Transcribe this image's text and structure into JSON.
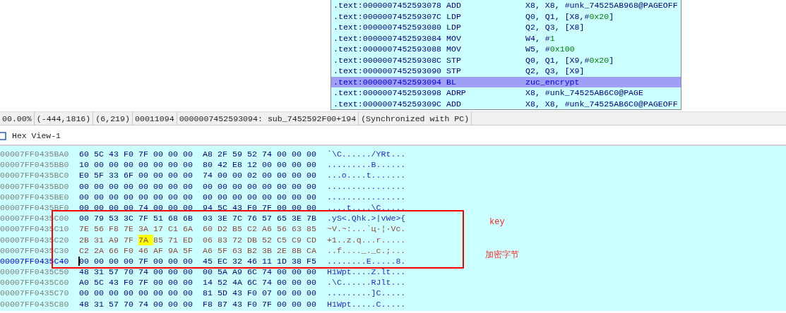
{
  "disassembly": {
    "lines": [
      {
        "address": ".text:0000007452593078",
        "mnemonic": "ADD",
        "operands": [
          {
            "kind": "plain",
            "text": "X8, X8, #unk_74525AB968@PAGEOFF"
          }
        ],
        "selected": false
      },
      {
        "address": ".text:000000745259307C",
        "mnemonic": "LDP",
        "operands": [
          {
            "kind": "plain",
            "text": "Q0, Q1, [X8,#"
          },
          {
            "kind": "number",
            "text": "0x20"
          },
          {
            "kind": "plain",
            "text": "]"
          }
        ],
        "selected": false
      },
      {
        "address": ".text:0000007452593080",
        "mnemonic": "LDP",
        "operands": [
          {
            "kind": "plain",
            "text": "Q2, Q3, [X8]"
          }
        ],
        "selected": false
      },
      {
        "address": ".text:0000007452593084",
        "mnemonic": "MOV",
        "operands": [
          {
            "kind": "plain",
            "text": "W4, #"
          },
          {
            "kind": "number",
            "text": "1"
          }
        ],
        "selected": false
      },
      {
        "address": ".text:0000007452593088",
        "mnemonic": "MOV",
        "operands": [
          {
            "kind": "plain",
            "text": "W5, #"
          },
          {
            "kind": "number",
            "text": "0x100"
          }
        ],
        "selected": false
      },
      {
        "address": ".text:000000745259308C",
        "mnemonic": "STP",
        "operands": [
          {
            "kind": "plain",
            "text": "Q0, Q1, [X9,#"
          },
          {
            "kind": "number",
            "text": "0x20"
          },
          {
            "kind": "plain",
            "text": "]"
          }
        ],
        "selected": false
      },
      {
        "address": ".text:0000007452593090",
        "mnemonic": "STP",
        "operands": [
          {
            "kind": "plain",
            "text": "Q2, Q3, [X9]"
          }
        ],
        "selected": false
      },
      {
        "address": ".text:0000007452593094",
        "mnemonic": "BL",
        "operands": [
          {
            "kind": "plain",
            "text": "zuc_encrypt"
          }
        ],
        "selected": true
      },
      {
        "address": ".text:0000007452593098",
        "mnemonic": "ADRP",
        "operands": [
          {
            "kind": "plain",
            "text": "X8, #unk_74525AB6C0@PAGE"
          }
        ],
        "selected": false
      },
      {
        "address": ".text:000000745259309C",
        "mnemonic": "ADD",
        "operands": [
          {
            "kind": "plain",
            "text": "X8, X8, #unk_74525AB6C0@PAGEOFF"
          }
        ],
        "selected": false
      }
    ]
  },
  "status_bar": {
    "segments": [
      "00.00%",
      "(-444,1816)",
      "(6,219)",
      "00011094",
      "0000007452593094: sub_7452592F00+194",
      "(Synchronized with PC)"
    ]
  },
  "hex_view": {
    "tab": {
      "title": "Hex View-1"
    },
    "rows": [
      {
        "address": "00007FF0435BA0",
        "bytes": [
          {
            "text": "60",
            "selected": false
          },
          {
            "text": "5C",
            "selected": false
          },
          {
            "text": "43",
            "selected": false
          },
          {
            "text": "F0",
            "selected": false
          },
          {
            "text": "7F",
            "selected": false
          },
          {
            "text": "00",
            "selected": false
          },
          {
            "text": "00",
            "selected": false
          },
          {
            "text": "00",
            "selected": false
          },
          {
            "text": "A8",
            "selected": false
          },
          {
            "text": "2F",
            "selected": false
          },
          {
            "text": "59",
            "selected": false
          },
          {
            "text": "52",
            "selected": false
          },
          {
            "text": "74",
            "selected": false
          },
          {
            "text": "00",
            "selected": false
          },
          {
            "text": "00",
            "selected": false
          },
          {
            "text": "00",
            "selected": false
          }
        ],
        "ascii": "`\\C....../YRt...",
        "current": false,
        "changed": false,
        "boxed": false
      },
      {
        "address": "00007FF0435BB0",
        "bytes": [
          {
            "text": "10",
            "selected": false
          },
          {
            "text": "00",
            "selected": false
          },
          {
            "text": "00",
            "selected": false
          },
          {
            "text": "00",
            "selected": false
          },
          {
            "text": "00",
            "selected": false
          },
          {
            "text": "00",
            "selected": false
          },
          {
            "text": "00",
            "selected": false
          },
          {
            "text": "00",
            "selected": false
          },
          {
            "text": "80",
            "selected": false
          },
          {
            "text": "42",
            "selected": false
          },
          {
            "text": "E8",
            "selected": false
          },
          {
            "text": "12",
            "selected": false
          },
          {
            "text": "00",
            "selected": false
          },
          {
            "text": "00",
            "selected": false
          },
          {
            "text": "00",
            "selected": false
          },
          {
            "text": "00",
            "selected": false
          }
        ],
        "ascii": ".........B......",
        "current": false,
        "changed": false,
        "boxed": false
      },
      {
        "address": "00007FF0435BC0",
        "bytes": [
          {
            "text": "E0",
            "selected": false
          },
          {
            "text": "5F",
            "selected": false
          },
          {
            "text": "33",
            "selected": false
          },
          {
            "text": "6F",
            "selected": false
          },
          {
            "text": "00",
            "selected": false
          },
          {
            "text": "00",
            "selected": false
          },
          {
            "text": "00",
            "selected": false
          },
          {
            "text": "00",
            "selected": false
          },
          {
            "text": "74",
            "selected": false
          },
          {
            "text": "00",
            "selected": false
          },
          {
            "text": "00",
            "selected": false
          },
          {
            "text": "02",
            "selected": false
          },
          {
            "text": "00",
            "selected": false
          },
          {
            "text": "00",
            "selected": false
          },
          {
            "text": "00",
            "selected": false
          },
          {
            "text": "00",
            "selected": false
          }
        ],
        "ascii": "...o....t.......",
        "current": false,
        "changed": false,
        "boxed": false
      },
      {
        "address": "00007FF0435BD0",
        "bytes": [
          {
            "text": "00",
            "selected": false
          },
          {
            "text": "00",
            "selected": false
          },
          {
            "text": "00",
            "selected": false
          },
          {
            "text": "00",
            "selected": false
          },
          {
            "text": "00",
            "selected": false
          },
          {
            "text": "00",
            "selected": false
          },
          {
            "text": "00",
            "selected": false
          },
          {
            "text": "00",
            "selected": false
          },
          {
            "text": "00",
            "selected": false
          },
          {
            "text": "00",
            "selected": false
          },
          {
            "text": "00",
            "selected": false
          },
          {
            "text": "00",
            "selected": false
          },
          {
            "text": "00",
            "selected": false
          },
          {
            "text": "00",
            "selected": false
          },
          {
            "text": "00",
            "selected": false
          },
          {
            "text": "00",
            "selected": false
          }
        ],
        "ascii": "................",
        "current": false,
        "changed": false,
        "boxed": false
      },
      {
        "address": "00007FF0435BE0",
        "bytes": [
          {
            "text": "00",
            "selected": false
          },
          {
            "text": "00",
            "selected": false
          },
          {
            "text": "00",
            "selected": false
          },
          {
            "text": "00",
            "selected": false
          },
          {
            "text": "00",
            "selected": false
          },
          {
            "text": "00",
            "selected": false
          },
          {
            "text": "00",
            "selected": false
          },
          {
            "text": "00",
            "selected": false
          },
          {
            "text": "00",
            "selected": false
          },
          {
            "text": "00",
            "selected": false
          },
          {
            "text": "00",
            "selected": false
          },
          {
            "text": "00",
            "selected": false
          },
          {
            "text": "00",
            "selected": false
          },
          {
            "text": "00",
            "selected": false
          },
          {
            "text": "00",
            "selected": false
          },
          {
            "text": "00",
            "selected": false
          }
        ],
        "ascii": "................",
        "current": false,
        "changed": false,
        "boxed": false
      },
      {
        "address": "00007FF0435BF0",
        "bytes": [
          {
            "text": "00",
            "selected": false
          },
          {
            "text": "00",
            "selected": false
          },
          {
            "text": "00",
            "selected": false
          },
          {
            "text": "00",
            "selected": false
          },
          {
            "text": "74",
            "selected": false
          },
          {
            "text": "00",
            "selected": false
          },
          {
            "text": "00",
            "selected": false
          },
          {
            "text": "00",
            "selected": false
          },
          {
            "text": "94",
            "selected": false
          },
          {
            "text": "5C",
            "selected": false
          },
          {
            "text": "43",
            "selected": false
          },
          {
            "text": "F0",
            "selected": false
          },
          {
            "text": "7F",
            "selected": false
          },
          {
            "text": "00",
            "selected": false
          },
          {
            "text": "00",
            "selected": false
          },
          {
            "text": "00",
            "selected": false
          }
        ],
        "ascii": "....t....\\C.....",
        "current": false,
        "changed": false,
        "boxed": false
      },
      {
        "address": "00007FF0435C00",
        "bytes": [
          {
            "text": "00",
            "selected": false
          },
          {
            "text": "79",
            "selected": false
          },
          {
            "text": "53",
            "selected": false
          },
          {
            "text": "3C",
            "selected": false
          },
          {
            "text": "7F",
            "selected": false
          },
          {
            "text": "51",
            "selected": false
          },
          {
            "text": "68",
            "selected": false
          },
          {
            "text": "6B",
            "selected": false
          },
          {
            "text": "03",
            "selected": false
          },
          {
            "text": "3E",
            "selected": false
          },
          {
            "text": "7C",
            "selected": false
          },
          {
            "text": "76",
            "selected": false
          },
          {
            "text": "57",
            "selected": false
          },
          {
            "text": "65",
            "selected": false
          },
          {
            "text": "3E",
            "selected": false
          },
          {
            "text": "7B",
            "selected": false
          }
        ],
        "ascii": ".yS<.Qhk.>|vWe>{",
        "current": false,
        "changed": false,
        "boxed": true
      },
      {
        "address": "00007FF0435C10",
        "bytes": [
          {
            "text": "7E",
            "selected": false
          },
          {
            "text": "56",
            "selected": false
          },
          {
            "text": "F8",
            "selected": false
          },
          {
            "text": "7E",
            "selected": false
          },
          {
            "text": "3A",
            "selected": false
          },
          {
            "text": "17",
            "selected": false
          },
          {
            "text": "C1",
            "selected": false
          },
          {
            "text": "6A",
            "selected": false
          },
          {
            "text": "60",
            "selected": false
          },
          {
            "text": "D2",
            "selected": false
          },
          {
            "text": "B5",
            "selected": false
          },
          {
            "text": "C2",
            "selected": false
          },
          {
            "text": "A6",
            "selected": false
          },
          {
            "text": "56",
            "selected": false
          },
          {
            "text": "63",
            "selected": false
          },
          {
            "text": "85",
            "selected": false
          }
        ],
        "ascii": "~V.~:...`ц·¦·Vc.",
        "current": false,
        "changed": true,
        "boxed": true
      },
      {
        "address": "00007FF0435C20",
        "bytes": [
          {
            "text": "2B",
            "selected": false
          },
          {
            "text": "31",
            "selected": false
          },
          {
            "text": "A9",
            "selected": false
          },
          {
            "text": "7F",
            "selected": false
          },
          {
            "text": "7A",
            "selected": true
          },
          {
            "text": "85",
            "selected": false
          },
          {
            "text": "71",
            "selected": false
          },
          {
            "text": "ED",
            "selected": false
          },
          {
            "text": "06",
            "selected": false
          },
          {
            "text": "83",
            "selected": false
          },
          {
            "text": "72",
            "selected": false
          },
          {
            "text": "DB",
            "selected": false
          },
          {
            "text": "52",
            "selected": false
          },
          {
            "text": "C5",
            "selected": false
          },
          {
            "text": "C9",
            "selected": false
          },
          {
            "text": "CD",
            "selected": false
          }
        ],
        "ascii": "+1..z.q...r.....",
        "current": false,
        "changed": true,
        "boxed": true
      },
      {
        "address": "00007FF0435C30",
        "bytes": [
          {
            "text": "C2",
            "selected": false
          },
          {
            "text": "2A",
            "selected": false
          },
          {
            "text": "66",
            "selected": false
          },
          {
            "text": "F0",
            "selected": false
          },
          {
            "text": "46",
            "selected": false
          },
          {
            "text": "AF",
            "selected": false
          },
          {
            "text": "9A",
            "selected": false
          },
          {
            "text": "5F",
            "selected": false
          },
          {
            "text": "A6",
            "selected": false
          },
          {
            "text": "5F",
            "selected": false
          },
          {
            "text": "63",
            "selected": false
          },
          {
            "text": "B2",
            "selected": false
          },
          {
            "text": "3B",
            "selected": false
          },
          {
            "text": "2E",
            "selected": false
          },
          {
            "text": "8B",
            "selected": false
          },
          {
            "text": "CA",
            "selected": false
          }
        ],
        "ascii": "..f...._._c.;...",
        "current": false,
        "changed": true,
        "boxed": true
      },
      {
        "address": "00007FF0435C40",
        "bytes": [
          {
            "text": "00",
            "selected": false
          },
          {
            "text": "00",
            "selected": false
          },
          {
            "text": "00",
            "selected": false
          },
          {
            "text": "00",
            "selected": false
          },
          {
            "text": "7F",
            "selected": false
          },
          {
            "text": "00",
            "selected": false
          },
          {
            "text": "00",
            "selected": false
          },
          {
            "text": "00",
            "selected": false
          },
          {
            "text": "45",
            "selected": false
          },
          {
            "text": "EC",
            "selected": false
          },
          {
            "text": "32",
            "selected": false
          },
          {
            "text": "46",
            "selected": false
          },
          {
            "text": "11",
            "selected": false
          },
          {
            "text": "1D",
            "selected": false
          },
          {
            "text": "38",
            "selected": false
          },
          {
            "text": "F5",
            "selected": false
          }
        ],
        "ascii": "........E.....8.",
        "current": true,
        "changed": false,
        "boxed": true
      },
      {
        "address": "00007FF0435C50",
        "bytes": [
          {
            "text": "48",
            "selected": false
          },
          {
            "text": "31",
            "selected": false
          },
          {
            "text": "57",
            "selected": false
          },
          {
            "text": "70",
            "selected": false
          },
          {
            "text": "74",
            "selected": false
          },
          {
            "text": "00",
            "selected": false
          },
          {
            "text": "00",
            "selected": false
          },
          {
            "text": "00",
            "selected": false
          },
          {
            "text": "00",
            "selected": false
          },
          {
            "text": "5A",
            "selected": false
          },
          {
            "text": "A9",
            "selected": false
          },
          {
            "text": "6C",
            "selected": false
          },
          {
            "text": "74",
            "selected": false
          },
          {
            "text": "00",
            "selected": false
          },
          {
            "text": "00",
            "selected": false
          },
          {
            "text": "00",
            "selected": false
          }
        ],
        "ascii": "H1Wpt....Z.lt...",
        "current": false,
        "changed": false,
        "boxed": false
      },
      {
        "address": "00007FF0435C60",
        "bytes": [
          {
            "text": "A0",
            "selected": false
          },
          {
            "text": "5C",
            "selected": false
          },
          {
            "text": "43",
            "selected": false
          },
          {
            "text": "F0",
            "selected": false
          },
          {
            "text": "7F",
            "selected": false
          },
          {
            "text": "00",
            "selected": false
          },
          {
            "text": "00",
            "selected": false
          },
          {
            "text": "00",
            "selected": false
          },
          {
            "text": "14",
            "selected": false
          },
          {
            "text": "52",
            "selected": false
          },
          {
            "text": "4A",
            "selected": false
          },
          {
            "text": "6C",
            "selected": false
          },
          {
            "text": "74",
            "selected": false
          },
          {
            "text": "00",
            "selected": false
          },
          {
            "text": "00",
            "selected": false
          },
          {
            "text": "00",
            "selected": false
          }
        ],
        "ascii": ".\\C......RJlt...",
        "current": false,
        "changed": false,
        "boxed": false
      },
      {
        "address": "00007FF0435C70",
        "bytes": [
          {
            "text": "00",
            "selected": false
          },
          {
            "text": "00",
            "selected": false
          },
          {
            "text": "00",
            "selected": false
          },
          {
            "text": "00",
            "selected": false
          },
          {
            "text": "00",
            "selected": false
          },
          {
            "text": "00",
            "selected": false
          },
          {
            "text": "00",
            "selected": false
          },
          {
            "text": "00",
            "selected": false
          },
          {
            "text": "81",
            "selected": false
          },
          {
            "text": "5D",
            "selected": false
          },
          {
            "text": "43",
            "selected": false
          },
          {
            "text": "F0",
            "selected": false
          },
          {
            "text": "07",
            "selected": false
          },
          {
            "text": "00",
            "selected": false
          },
          {
            "text": "00",
            "selected": false
          },
          {
            "text": "00",
            "selected": false
          }
        ],
        "ascii": ".........]C.....",
        "current": false,
        "changed": false,
        "boxed": false
      },
      {
        "address": "00007FF0435C80",
        "bytes": [
          {
            "text": "48",
            "selected": false
          },
          {
            "text": "31",
            "selected": false
          },
          {
            "text": "57",
            "selected": false
          },
          {
            "text": "70",
            "selected": false
          },
          {
            "text": "74",
            "selected": false
          },
          {
            "text": "00",
            "selected": false
          },
          {
            "text": "00",
            "selected": false
          },
          {
            "text": "00",
            "selected": false
          },
          {
            "text": "F8",
            "selected": false
          },
          {
            "text": "87",
            "selected": false
          },
          {
            "text": "43",
            "selected": false
          },
          {
            "text": "F0",
            "selected": false
          },
          {
            "text": "7F",
            "selected": false
          },
          {
            "text": "00",
            "selected": false
          },
          {
            "text": "00",
            "selected": false
          },
          {
            "text": "00",
            "selected": false
          }
        ],
        "ascii": "H1Wpt.....C.....",
        "current": false,
        "changed": false,
        "boxed": false
      }
    ],
    "annotations": [
      {
        "text": "key"
      },
      {
        "text": "加密字节"
      }
    ]
  }
}
